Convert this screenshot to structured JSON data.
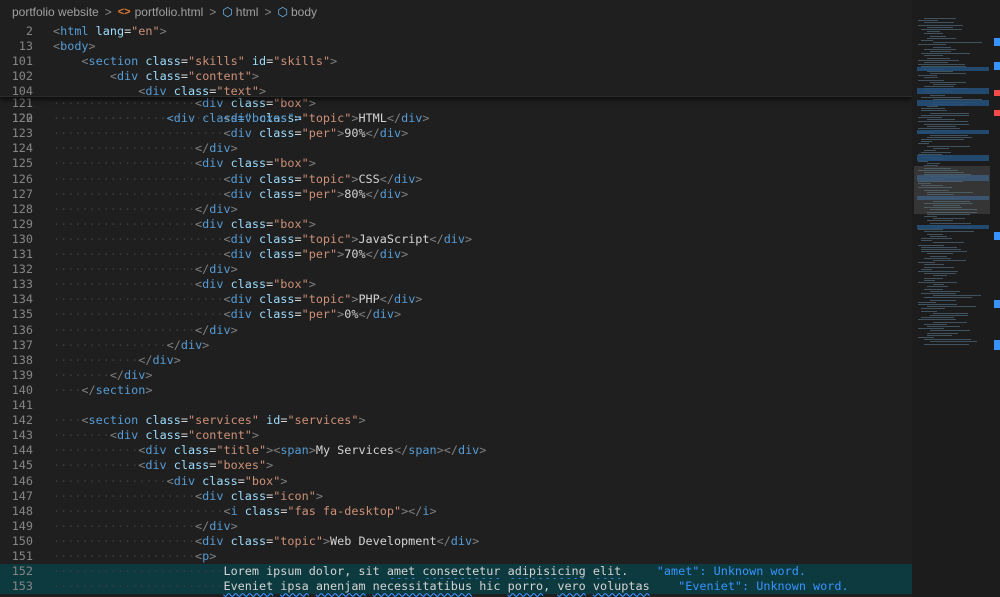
{
  "breadcrumb": {
    "folder": "portfolio website",
    "file": "portfolio.html",
    "element1": "html",
    "element2": "body",
    "separator": ">"
  },
  "icons": {
    "html_file": "html-file-icon",
    "symbol": "symbol-element-icon"
  },
  "sticky_lines": [
    {
      "n": "2",
      "indent": 0,
      "tag": "html",
      "attrs": [
        {
          "name": "lang",
          "value": "\"en\""
        }
      ]
    },
    {
      "n": "13",
      "indent": 0,
      "tag": "body",
      "attrs": []
    },
    {
      "n": "101",
      "indent": 1,
      "tag": "section",
      "attrs": [
        {
          "name": "class",
          "value": "\"skills\""
        },
        {
          "name": "id",
          "value": "\"skills\""
        }
      ]
    },
    {
      "n": "102",
      "indent": 2,
      "tag": "div",
      "attrs": [
        {
          "name": "class",
          "value": "\"content\""
        }
      ]
    },
    {
      "n": "104",
      "indent": 3,
      "tag": "div",
      "attrs": [
        {
          "name": "class",
          "value": "\"text\""
        }
      ]
    }
  ],
  "partial_line": {
    "n": "120",
    "text": "<div class=\"boxes\">"
  },
  "lines": [
    {
      "n": "121",
      "indent": 5,
      "kind": "open",
      "tag": "div",
      "attrs": [
        {
          "name": "class",
          "value": "\"box\""
        }
      ]
    },
    {
      "n": "122",
      "indent": 6,
      "kind": "inline",
      "tag": "div",
      "attrs": [
        {
          "name": "class",
          "value": "\"topic\""
        }
      ],
      "text": "HTML"
    },
    {
      "n": "123",
      "indent": 6,
      "kind": "inline",
      "tag": "div",
      "attrs": [
        {
          "name": "class",
          "value": "\"per\""
        }
      ],
      "text": "90%"
    },
    {
      "n": "124",
      "indent": 5,
      "kind": "close",
      "tag": "div"
    },
    {
      "n": "125",
      "indent": 5,
      "kind": "open",
      "tag": "div",
      "attrs": [
        {
          "name": "class",
          "value": "\"box\""
        }
      ]
    },
    {
      "n": "126",
      "indent": 6,
      "kind": "inline",
      "tag": "div",
      "attrs": [
        {
          "name": "class",
          "value": "\"topic\""
        }
      ],
      "text": "CSS"
    },
    {
      "n": "127",
      "indent": 6,
      "kind": "inline",
      "tag": "div",
      "attrs": [
        {
          "name": "class",
          "value": "\"per\""
        }
      ],
      "text": "80%"
    },
    {
      "n": "128",
      "indent": 5,
      "kind": "close",
      "tag": "div"
    },
    {
      "n": "129",
      "indent": 5,
      "kind": "open",
      "tag": "div",
      "attrs": [
        {
          "name": "class",
          "value": "\"box\""
        }
      ]
    },
    {
      "n": "130",
      "indent": 6,
      "kind": "inline",
      "tag": "div",
      "attrs": [
        {
          "name": "class",
          "value": "\"topic\""
        }
      ],
      "text": "JavaScript"
    },
    {
      "n": "131",
      "indent": 6,
      "kind": "inline",
      "tag": "div",
      "attrs": [
        {
          "name": "class",
          "value": "\"per\""
        }
      ],
      "text": "70%"
    },
    {
      "n": "132",
      "indent": 5,
      "kind": "close",
      "tag": "div"
    },
    {
      "n": "133",
      "indent": 5,
      "kind": "open",
      "tag": "div",
      "attrs": [
        {
          "name": "class",
          "value": "\"box\""
        }
      ]
    },
    {
      "n": "134",
      "indent": 6,
      "kind": "inline",
      "tag": "div",
      "attrs": [
        {
          "name": "class",
          "value": "\"topic\""
        }
      ],
      "text": "PHP"
    },
    {
      "n": "135",
      "indent": 6,
      "kind": "inline",
      "tag": "div",
      "attrs": [
        {
          "name": "class",
          "value": "\"per\""
        }
      ],
      "text": "0%"
    },
    {
      "n": "136",
      "indent": 5,
      "kind": "close",
      "tag": "div"
    },
    {
      "n": "137",
      "indent": 4,
      "kind": "close",
      "tag": "div"
    },
    {
      "n": "138",
      "indent": 3,
      "kind": "close",
      "tag": "div"
    },
    {
      "n": "139",
      "indent": 2,
      "kind": "close",
      "tag": "div"
    },
    {
      "n": "140",
      "indent": 1,
      "kind": "close",
      "tag": "section"
    },
    {
      "n": "141",
      "indent": 0,
      "kind": "blank"
    },
    {
      "n": "142",
      "indent": 1,
      "kind": "open",
      "tag": "section",
      "attrs": [
        {
          "name": "class",
          "value": "\"services\""
        },
        {
          "name": "id",
          "value": "\"services\""
        }
      ]
    },
    {
      "n": "143",
      "indent": 2,
      "kind": "open",
      "tag": "div",
      "attrs": [
        {
          "name": "class",
          "value": "\"content\""
        }
      ]
    },
    {
      "n": "144",
      "indent": 3,
      "kind": "nested",
      "tag": "div",
      "attrs": [
        {
          "name": "class",
          "value": "\"title\""
        }
      ],
      "inner": "span",
      "text": "My Services"
    },
    {
      "n": "145",
      "indent": 3,
      "kind": "open",
      "tag": "div",
      "attrs": [
        {
          "name": "class",
          "value": "\"boxes\""
        }
      ]
    },
    {
      "n": "146",
      "indent": 4,
      "kind": "open",
      "tag": "div",
      "attrs": [
        {
          "name": "class",
          "value": "\"box\""
        }
      ]
    },
    {
      "n": "147",
      "indent": 5,
      "kind": "open",
      "tag": "div",
      "attrs": [
        {
          "name": "class",
          "value": "\"icon\""
        }
      ]
    },
    {
      "n": "148",
      "indent": 6,
      "kind": "inline",
      "tag": "i",
      "attrs": [
        {
          "name": "class",
          "value": "\"fas fa-desktop\""
        }
      ],
      "text": ""
    },
    {
      "n": "149",
      "indent": 5,
      "kind": "close",
      "tag": "div"
    },
    {
      "n": "150",
      "indent": 5,
      "kind": "inline",
      "tag": "div",
      "attrs": [
        {
          "name": "class",
          "value": "\"topic\""
        }
      ],
      "text": "Web Development"
    },
    {
      "n": "151",
      "indent": 5,
      "kind": "open",
      "tag": "p",
      "attrs": []
    },
    {
      "n": "152",
      "indent": 6,
      "kind": "prose",
      "highlight": true,
      "segments": [
        {
          "t": "Lorem ipsum dolor, sit "
        },
        {
          "t": "amet",
          "w": true
        },
        {
          "t": " "
        },
        {
          "t": "consectetur",
          "w": true
        },
        {
          "t": " "
        },
        {
          "t": "adipisicing",
          "w": true
        },
        {
          "t": " "
        },
        {
          "t": "elit",
          "w": true
        },
        {
          "t": "."
        }
      ],
      "diagnostic": "\"amet\": Unknown word."
    },
    {
      "n": "153",
      "indent": 6,
      "kind": "prose",
      "highlight": true,
      "segments": [
        {
          "t": "Eveniet",
          "w": true
        },
        {
          "t": " "
        },
        {
          "t": "ipsa",
          "w": true
        },
        {
          "t": " "
        },
        {
          "t": "anenjam",
          "w": true
        },
        {
          "t": " "
        },
        {
          "t": "necessitatibus",
          "w": true
        },
        {
          "t": " hic "
        },
        {
          "t": "porro",
          "w": true
        },
        {
          "t": ", "
        },
        {
          "t": "vero",
          "w": true
        },
        {
          "t": " "
        },
        {
          "t": "voluptas",
          "w": true
        }
      ],
      "diagnostic": "\"Eveniet\": Unknown word."
    }
  ],
  "colors": {
    "background": "#1f1f1f",
    "line_number": "#858585",
    "tag": "#569cd6",
    "attribute": "#9cdcfe",
    "string": "#ce9178",
    "punctuation": "#808080",
    "text": "#d4d4d4",
    "diagnostic": "#3794ff",
    "highlight": "#0c3a3f"
  }
}
